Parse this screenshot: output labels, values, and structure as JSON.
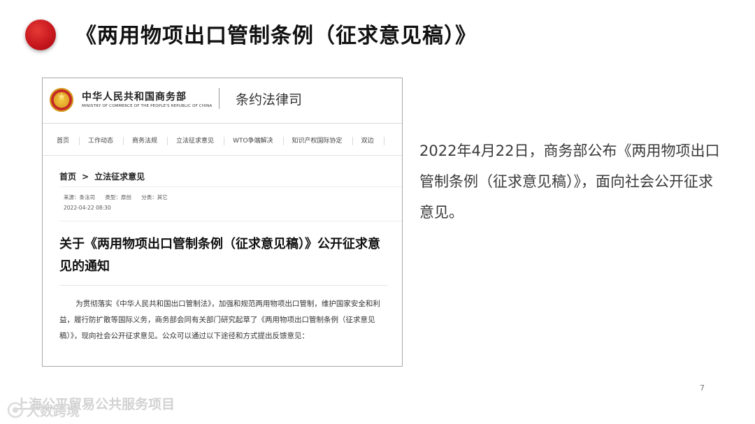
{
  "slide": {
    "title": "《两用物项出口管制条例（征求意见稿）》",
    "description": "2022年4月22日，商务部公布《两用物项出口管制条例（征求意见稿）》，面向社会公开征求意见。",
    "page_number": "7",
    "footer_watermark": "上海公平贸易公共服务项目",
    "brand_watermark": "大数跨境"
  },
  "site": {
    "ministry_cn": "中华人民共和国商务部",
    "ministry_en": "MINISTRY OF COMMERCE OF THE PEOPLE'S REPUBLIC OF CHINA",
    "department": "条约法律司",
    "nav": [
      "首页",
      "工作动态",
      "商务法规",
      "立法征求意见",
      "WTO争端解决",
      "知识产权国际协定",
      "双边"
    ],
    "breadcrumb": {
      "home": "首页",
      "separator": ">",
      "current": "立法征求意见"
    },
    "meta": {
      "source": "来源：条法司",
      "type": "类型：原创",
      "category": "分类：其它",
      "date": "2022-04-22 08:30"
    },
    "article": {
      "title": "关于《两用物项出口管制条例（征求意见稿）》公开征求意见的通知",
      "body": "为贯彻落实《中华人民共和国出口管制法》，加强和规范两用物项出口管制，维护国家安全和利益，履行防扩散等国际义务，商务部会同有关部门研究起草了《两用物项出口管制条例（征求意见稿）》，现向社会公开征求意见。公众可以通过以下途径和方式提出反馈意见："
    }
  },
  "colors": {
    "accent_red": "#c4151c",
    "emblem_gold": "#e0a526"
  }
}
